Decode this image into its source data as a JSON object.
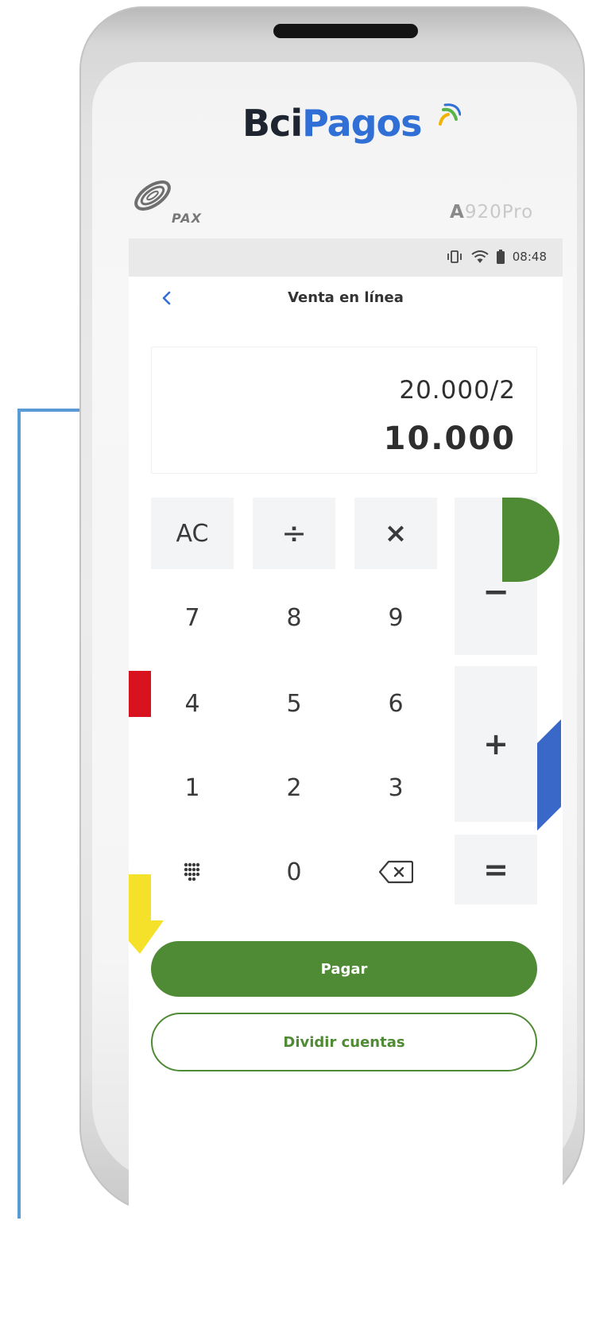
{
  "device": {
    "brand_part1": "Bci",
    "brand_part2": "Pagos",
    "maker": "PAX",
    "model_prefix": "A",
    "model_suffix": "920Pro"
  },
  "status_bar": {
    "time": "08:48",
    "icons": [
      "vibrate-icon",
      "wifi-icon",
      "battery-icon"
    ]
  },
  "nav": {
    "title": "Venta en línea",
    "back_icon": "chevron-left-icon"
  },
  "display": {
    "expression": "20.000/2",
    "result": "10.000"
  },
  "keypad": {
    "clear": "AC",
    "divide": "÷",
    "multiply": "×",
    "minus": "−",
    "plus": "+",
    "equals": "=",
    "digits": [
      "7",
      "8",
      "9",
      "4",
      "5",
      "6",
      "1",
      "2",
      "3",
      "0"
    ],
    "keyboard_icon": "dialpad-icon",
    "backspace_icon": "backspace-icon"
  },
  "actions": {
    "pay": "Pagar",
    "split": "Dividir cuentas"
  },
  "colors": {
    "accent_green": "#4f8a34",
    "brand_blue": "#2f6fd6",
    "annotation_blue": "#5b9bd5",
    "deco_red": "#d9121f",
    "deco_yellow": "#f5e12a",
    "deco_blue": "#3a68c8"
  }
}
